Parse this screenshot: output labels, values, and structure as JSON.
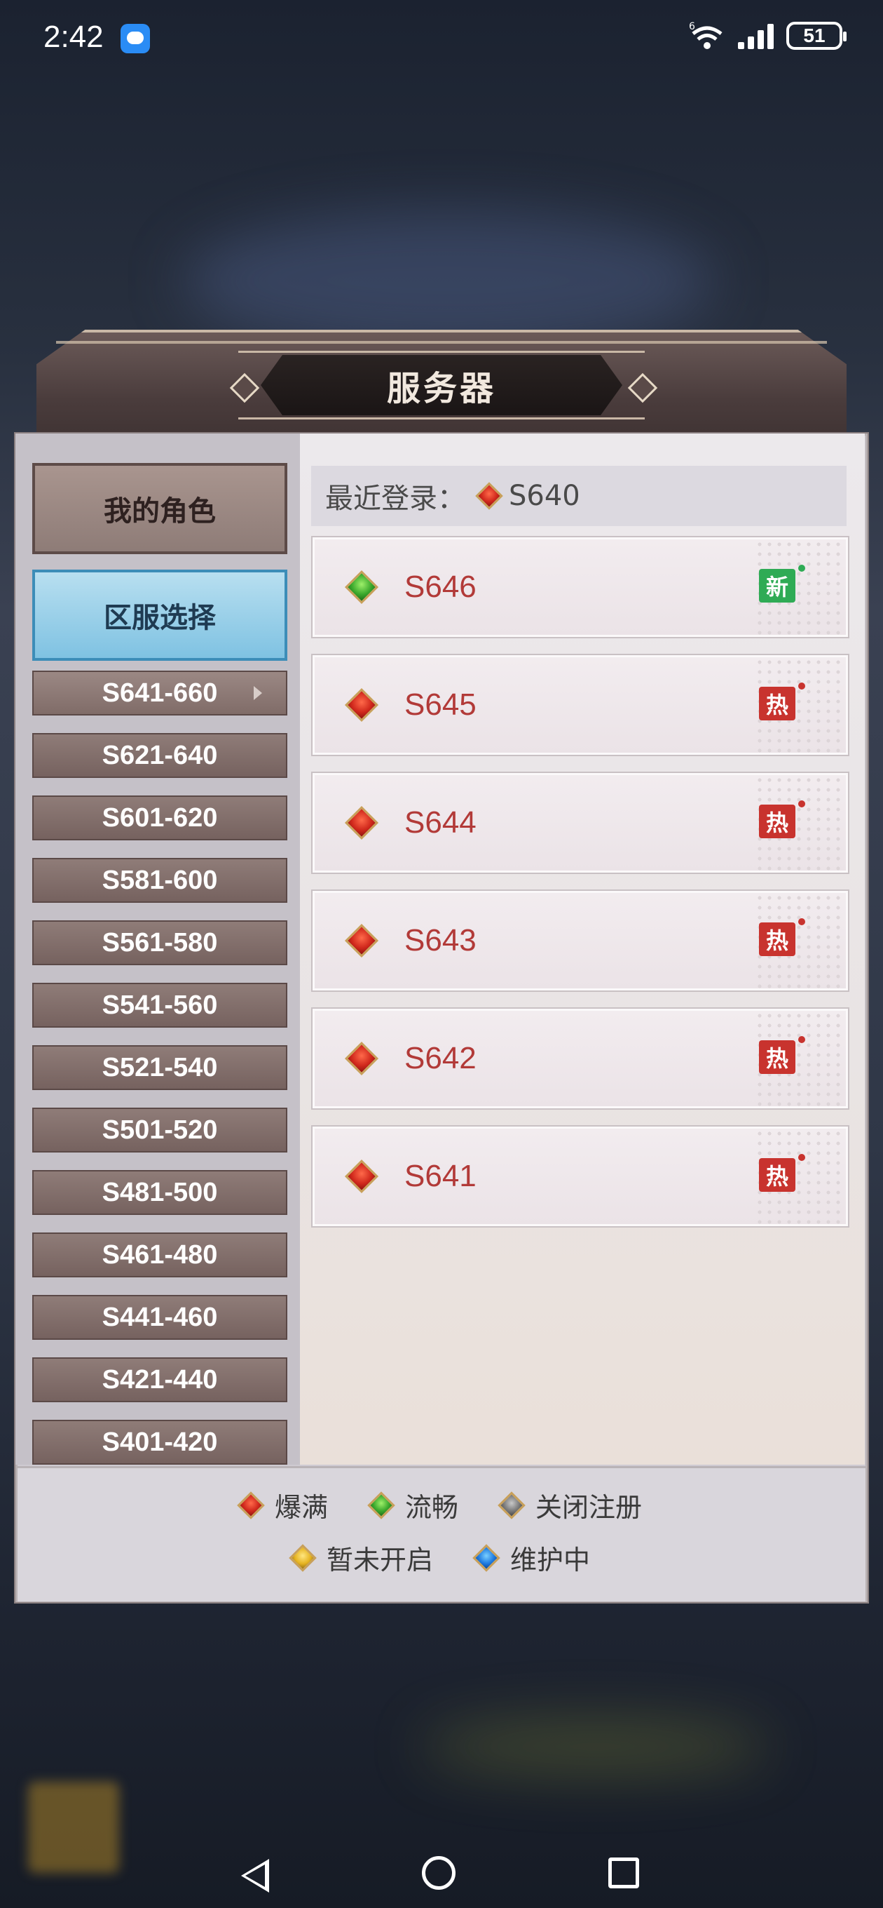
{
  "status_bar": {
    "time": "2:42",
    "network": "6",
    "battery": "51"
  },
  "panel": {
    "title": "服务器"
  },
  "sidebar": {
    "my_role": "我的角色",
    "zone_select": "区服选择",
    "ranges": [
      "S641-660",
      "S621-640",
      "S601-620",
      "S581-600",
      "S561-580",
      "S541-560",
      "S521-540",
      "S501-520",
      "S481-500",
      "S461-480",
      "S441-460",
      "S421-440",
      "S401-420"
    ]
  },
  "recent": {
    "label": "最近登录：",
    "server": "S640",
    "status": "red"
  },
  "servers": [
    {
      "name": "S646",
      "status": "green",
      "tag": "新"
    },
    {
      "name": "S645",
      "status": "red",
      "tag": "热"
    },
    {
      "name": "S644",
      "status": "red",
      "tag": "热"
    },
    {
      "name": "S643",
      "status": "red",
      "tag": "热"
    },
    {
      "name": "S642",
      "status": "red",
      "tag": "热"
    },
    {
      "name": "S641",
      "status": "red",
      "tag": "热"
    }
  ],
  "legend": {
    "full": "爆满",
    "smooth": "流畅",
    "closed": "关闭注册",
    "not_open": "暂未开启",
    "maintenance": "维护中"
  },
  "colors": {
    "hot_tag": "#c8332e",
    "new_tag": "#2fab55",
    "server_name": "#b23a38",
    "selected_tab": "#7fc2e2"
  }
}
